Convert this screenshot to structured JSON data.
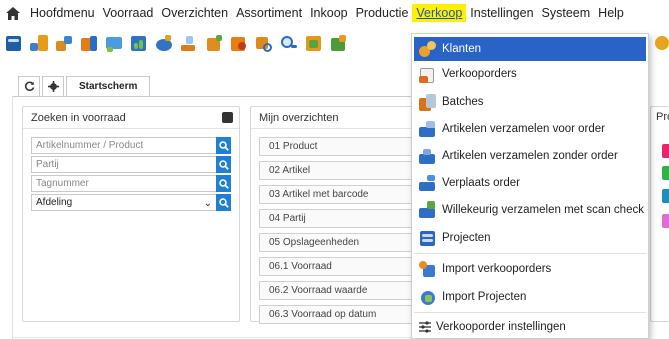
{
  "menubar": {
    "items": [
      "Hoofdmenu",
      "Voorraad",
      "Overzichten",
      "Assortiment",
      "Inkoop",
      "Productie",
      "Verkoop",
      "Instellingen",
      "Systeem",
      "Help"
    ],
    "active": "Verkoop"
  },
  "toolbar": {
    "icons": [
      "module-icon-1",
      "module-icon-2",
      "module-icon-3",
      "module-icon-4",
      "module-icon-5",
      "module-icon-6",
      "module-icon-7",
      "module-icon-8",
      "module-icon-9",
      "module-icon-10",
      "module-icon-11",
      "module-icon-12",
      "module-icon-13",
      "module-icon-14",
      "module-icon-15"
    ]
  },
  "tabs": {
    "home_label": "Startscherm"
  },
  "search_panel": {
    "title": "Zoeken in voorraad",
    "fields": [
      {
        "placeholder": "Artikelnummer / Product"
      },
      {
        "placeholder": "Partij"
      },
      {
        "placeholder": "Tagnummer"
      }
    ],
    "select": {
      "value": "Afdeling",
      "caret": "⌄"
    }
  },
  "overviews_panel": {
    "title": "Mijn overzichten",
    "items": [
      "01 Product",
      "02 Artikel",
      "03 Artikel met barcode",
      "04 Partij",
      "05 Opslageenheden",
      "06.1 Voorraad",
      "06.2 Voorraad waarde",
      "06.3 Voorraad op datum"
    ]
  },
  "third_panel": {
    "title_visible": "Pro"
  },
  "dropdown": {
    "items": [
      {
        "label": "Klanten",
        "icon": "customers-icon",
        "selected": true
      },
      {
        "label": "Verkooporders",
        "icon": "sales-orders-icon"
      },
      {
        "label": "Batches",
        "icon": "batches-icon"
      },
      {
        "label": "Artikelen verzamelen voor order",
        "icon": "collect-for-order-icon"
      },
      {
        "label": "Artikelen verzamelen zonder order",
        "icon": "collect-without-order-icon"
      },
      {
        "label": "Verplaats order",
        "icon": "move-order-icon"
      },
      {
        "label": "Willekeurig verzamelen met scan check",
        "icon": "random-collect-icon"
      },
      {
        "label": "Projecten",
        "icon": "projects-icon"
      },
      {
        "label": "Import verkooporders",
        "icon": "import-sales-orders-icon"
      },
      {
        "label": "Import Projecten",
        "icon": "import-projects-icon"
      },
      {
        "label": "Verkooporder instellingen",
        "icon": "settings-lines-icon"
      }
    ]
  },
  "colors": {
    "active_menu_bg": "#ffef00",
    "active_menu_text": "#1a55c4",
    "selected_item_bg": "#2a63c6",
    "search_button": "#1f7fd4"
  }
}
